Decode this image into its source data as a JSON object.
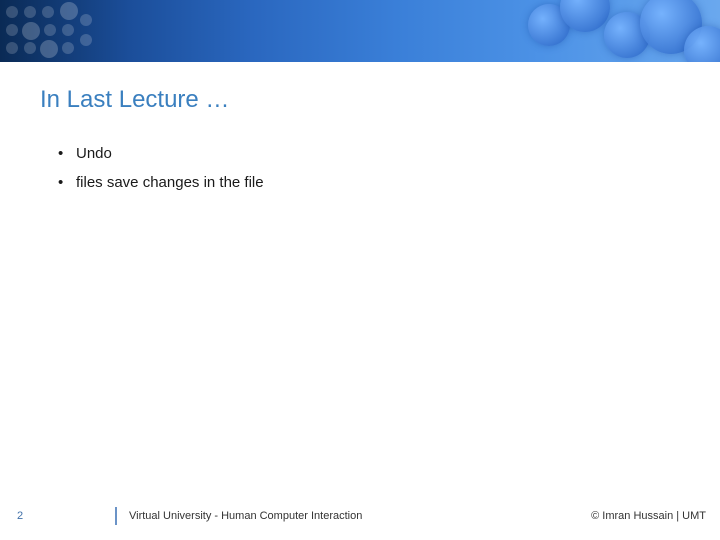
{
  "slide": {
    "title": "In Last Lecture …",
    "bullets": [
      "Undo",
      "files save changes in the file"
    ]
  },
  "footer": {
    "page_number": "2",
    "course": "Virtual University - Human Computer Interaction",
    "copyright": "© Imran Hussain | UMT"
  }
}
